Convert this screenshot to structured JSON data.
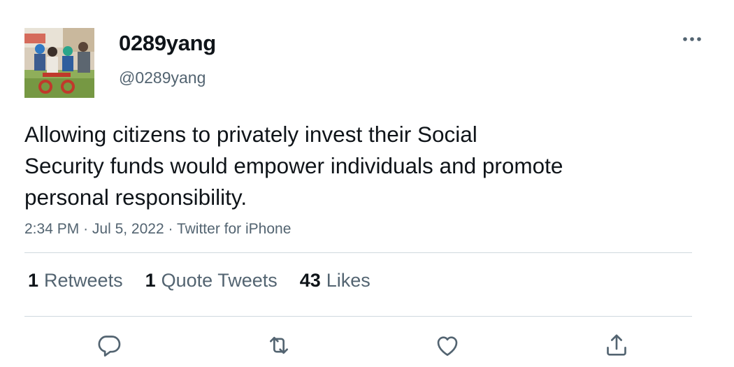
{
  "user": {
    "display_name": "0289yang",
    "handle": "@0289yang",
    "avatar_icon": "family-photo-avatar"
  },
  "tweet": {
    "lines": [
      "Allowing citizens to privately invest their Social",
      "Security funds would empower individuals and promote",
      "personal responsibility."
    ]
  },
  "meta": {
    "time": "2:34 PM",
    "date": "Jul 5, 2022",
    "source": "Twitter for iPhone",
    "separator": "·"
  },
  "stats": [
    {
      "count": "1",
      "label": "Retweets"
    },
    {
      "count": "1",
      "label": "Quote Tweets"
    },
    {
      "count": "43",
      "label": "Likes"
    }
  ],
  "actions": [
    {
      "icon": "reply-icon"
    },
    {
      "icon": "retweet-icon"
    },
    {
      "icon": "like-icon"
    },
    {
      "icon": "share-icon"
    }
  ],
  "colors": {
    "text": "#0f1419",
    "secondary": "#536471",
    "divider": "#cfd9de"
  }
}
